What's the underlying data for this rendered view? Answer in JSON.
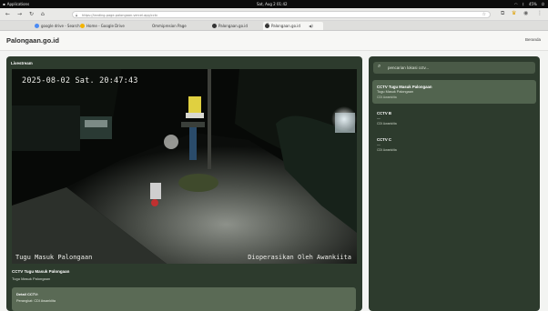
{
  "system": {
    "apps_label": "Applications",
    "clock": "Sat, Aug 2   01:42",
    "battery": "45%"
  },
  "browser": {
    "url": "https://landing-page-palongaan.vercel.app/cctv",
    "tabs": [
      {
        "label": "google drive - Search",
        "icon_color": "#4a8af4"
      },
      {
        "label": "Home - Google Drive",
        "icon_color": "#f4b400"
      },
      {
        "label": "Ommipresion Page",
        "icon_color": "#9aa0a6"
      },
      {
        "label": "Palongaan.go.id",
        "icon_color": "#333333"
      },
      {
        "label": "Palongaan.go.id",
        "icon_color": "#333333"
      }
    ],
    "icons": [
      "back-icon",
      "forward-icon",
      "reload-icon",
      "home-icon",
      "lock-icon",
      "star-icon",
      "extensions-icon",
      "profile-icon",
      "menu-icon"
    ]
  },
  "site": {
    "logo": "Palongaan.go.id",
    "nav_home": "Beranda"
  },
  "livestream": {
    "title": "Livestream",
    "osd_timestamp": "2025-08-02 Sat. 20:47:43",
    "osd_location": "Tugu Masuk Palongaan",
    "osd_operator": "Dioperasikan Oleh Awankiita",
    "camera_name": "CCTV Tugu Masuk Palongaan",
    "camera_location": "Tugu Masuk Palongaan",
    "detail_heading": "Detail CCTV:",
    "detail_device": "Perangkat: CDI Awankiita"
  },
  "sidebar": {
    "search_placeholder": "pencarian lokasi cctv...",
    "cameras": [
      {
        "name": "CCTV Tugu Masuk Palongaan",
        "location": "Tugu Masuk Palongaan",
        "operator": "CDI Awankiita",
        "selected": true
      },
      {
        "name": "CCTV B",
        "location": "—",
        "operator": "CDI Awankiita",
        "selected": false
      },
      {
        "name": "CCTV C",
        "location": "—",
        "operator": "CDI Awankiita",
        "selected": false
      }
    ]
  },
  "colors": {
    "panel": "#2d3b2d",
    "selected_item": "#52644f",
    "detail_box": "#5a6a55"
  }
}
